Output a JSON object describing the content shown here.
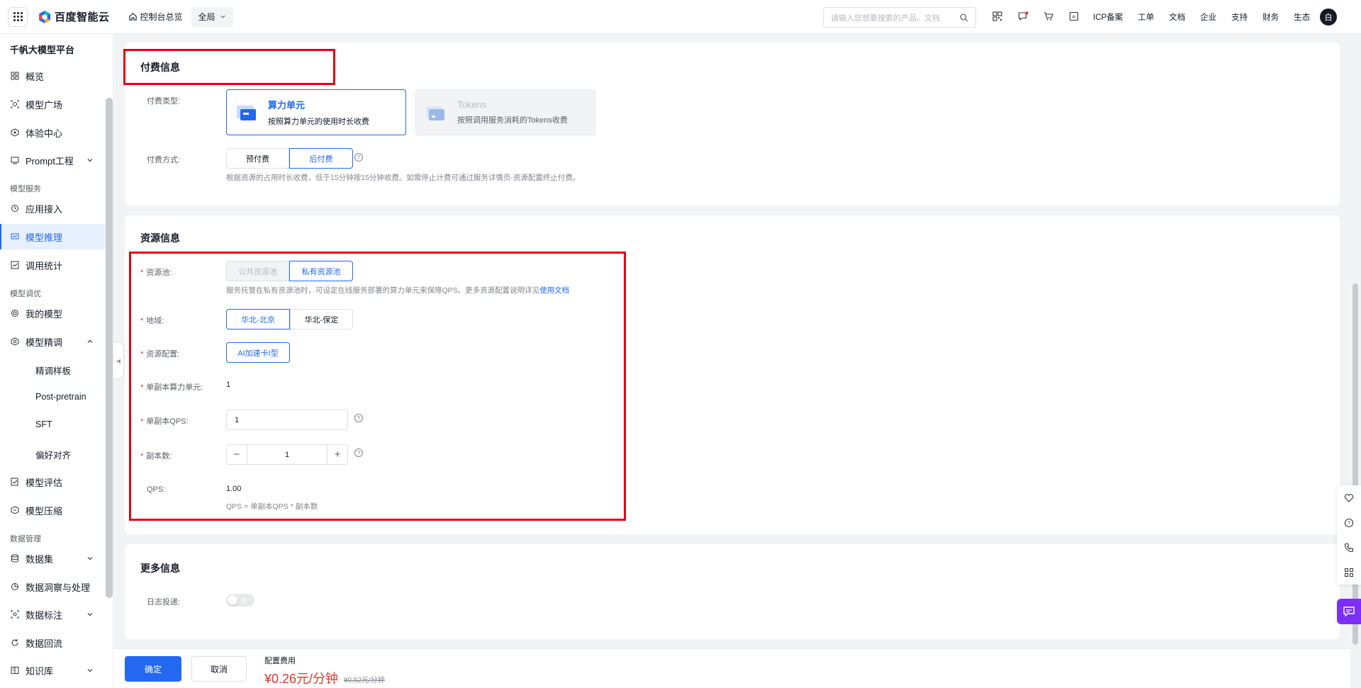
{
  "header": {
    "brand": "百度智能云",
    "console_home": "控制台总览",
    "region": "全局",
    "search_placeholder": "请输入您想要搜索的产品、文档",
    "nav": [
      "ICP备案",
      "工单",
      "文档",
      "企业",
      "支持",
      "财务",
      "生态"
    ],
    "avatar": "白",
    "icons": [
      "qrcode-icon",
      "message-icon",
      "cart-icon",
      "ai-icon"
    ]
  },
  "sidebar": {
    "title": "千帆大模型平台",
    "items": [
      {
        "label": "概览",
        "icon": "overview-icon"
      },
      {
        "label": "模型广场",
        "icon": "model-square-icon"
      },
      {
        "label": "体验中心",
        "icon": "experience-icon"
      },
      {
        "label": "Prompt工程",
        "icon": "prompt-icon"
      },
      {
        "label": "应用接入",
        "icon": "app-access-icon"
      },
      {
        "label": "模型推理",
        "icon": "inference-icon"
      },
      {
        "label": "调用统计",
        "icon": "stats-icon"
      },
      {
        "label": "我的模型",
        "icon": "my-model-icon"
      },
      {
        "label": "模型精调",
        "icon": "finetune-icon"
      },
      {
        "label": "模型评估",
        "icon": "evaluate-icon"
      },
      {
        "label": "模型压缩",
        "icon": "compress-icon"
      },
      {
        "label": "数据集",
        "icon": "dataset-icon"
      },
      {
        "label": "数据洞察与处理",
        "icon": "insight-icon"
      },
      {
        "label": "数据标注",
        "icon": "annotate-icon"
      },
      {
        "label": "数据回流",
        "icon": "reflow-icon"
      },
      {
        "label": "知识库",
        "icon": "knowledge-icon"
      }
    ],
    "groups": [
      "模型服务",
      "模型调优",
      "数据管理"
    ],
    "sub_items": [
      "精调样板",
      "Post-pretrain",
      "SFT",
      "偏好对齐"
    ]
  },
  "billing": {
    "title": "付费信息",
    "type_label": "付费类型:",
    "type_options": [
      {
        "title": "算力单元",
        "desc": "按照算力单元的使用时长收费"
      },
      {
        "title": "Tokens",
        "desc": "按照调用服务消耗的Tokens收费"
      }
    ],
    "method_label": "付费方式:",
    "method_options": [
      "预付费",
      "后付费"
    ],
    "method_hint": "根据资源的占用时长收费，低于15分钟按15分钟收费。如需停止计费可通过服务详情页-资源配置终止付费。"
  },
  "resource": {
    "title": "资源信息",
    "pool_label": "资源池:",
    "pool_options": [
      "公共资源池",
      "私有资源池"
    ],
    "pool_hint": "服务托管在私有资源池时，可设定在线服务部署的算力单元来保障QPS。更多资源配置说明详见",
    "pool_hint_link": "使用文档",
    "region_label": "地域:",
    "region_options": [
      "华北-北京",
      "华北-保定"
    ],
    "config_label": "资源配置:",
    "config_value": "AI加速卡I型",
    "unit_label": "单副本算力单元:",
    "unit_value": "1",
    "qps_label": "单副本QPS:",
    "qps_value": "1",
    "replica_label": "副本数:",
    "replica_value": "1",
    "total_qps_label": "QPS:",
    "total_qps_value": "1.00",
    "total_qps_formula": "QPS = 单副本QPS * 副本数"
  },
  "more": {
    "title": "更多信息",
    "log_label": "日志投递:",
    "log_toggle": "关",
    "log_enabled": false
  },
  "footer": {
    "confirm": "确定",
    "cancel": "取消",
    "fee_label": "配置费用",
    "fee_price": "¥0.26元/分钟",
    "fee_original": "¥0.52元/分钟"
  },
  "colors": {
    "accent": "#2468f2",
    "highlight_border": "#e60012",
    "price": "#e8352b"
  }
}
